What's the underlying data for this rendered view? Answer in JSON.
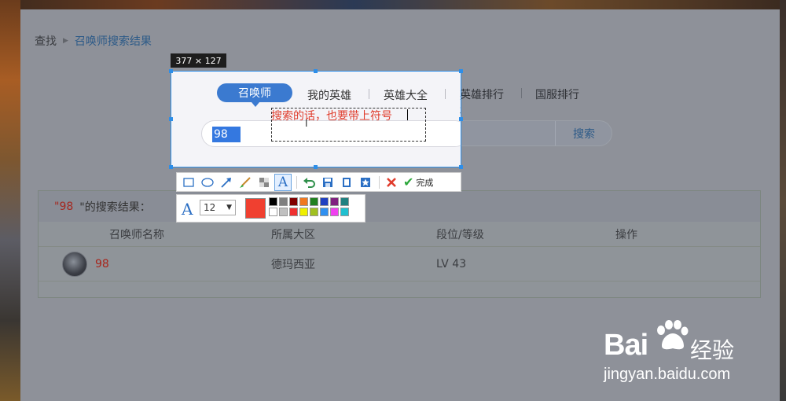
{
  "breadcrumb": {
    "root": "查找",
    "current": "召唤师搜索结果"
  },
  "capture": {
    "size_label": "377 × 127"
  },
  "tabs": [
    "召唤师",
    "我的英雄",
    "英雄大全",
    "英雄排行",
    "国服排行"
  ],
  "search": {
    "value": "98",
    "button": "搜索"
  },
  "annotation": {
    "text": "搜索的话，也要带上符号"
  },
  "results": {
    "header_prefix": "\"98",
    "header_suffix": "\"的搜索结果：",
    "columns": [
      "召唤师名称",
      "所属大区",
      "段位/等级",
      "操作"
    ],
    "rows": [
      {
        "name": "98",
        "region": "德玛西亚",
        "level": "LV 43"
      }
    ]
  },
  "toolbar": {
    "tools": [
      "rectangle-icon",
      "ellipse-icon",
      "arrow-icon",
      "brush-icon",
      "mosaic-icon",
      "text-icon",
      "undo-icon",
      "save-icon",
      "copy-icon",
      "pin-icon",
      "cancel-icon"
    ],
    "done_label": "完成"
  },
  "text_props": {
    "font_size": "12",
    "current_color": "#f04030",
    "palette": [
      "#000000",
      "#808080",
      "#800000",
      "#f07820",
      "#208020",
      "#2040c0",
      "#802080",
      "#208080",
      "#ffffff",
      "#c0c0c0",
      "#f03030",
      "#f0f000",
      "#a0c020",
      "#3090f0",
      "#f040f0",
      "#20c0d0"
    ]
  },
  "watermark": {
    "brand": "Bai",
    "product": "经验",
    "url": "jingyan.baidu.com"
  }
}
